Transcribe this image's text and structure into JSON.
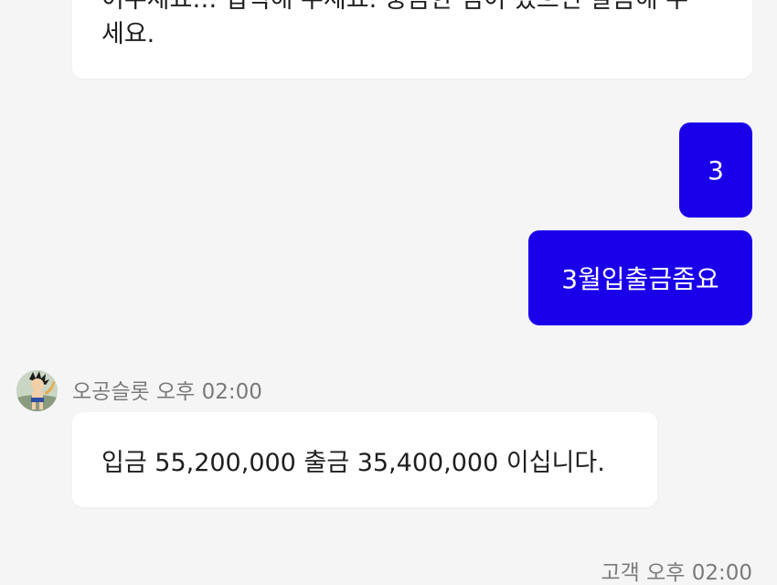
{
  "messages": {
    "previous": {
      "line1": "어주세요… 입력해 주세요. 궁금한 점이 있으면 말씀해 주",
      "line2": "세요."
    },
    "outgoing": [
      {
        "text": "3"
      },
      {
        "text": "3월입출금좀요"
      }
    ],
    "incoming": {
      "sender": "오공슬롯",
      "time": "오후 02:00",
      "text": "입금 55,200,000 출금 35,400,000 이십니다."
    },
    "customer": {
      "label": "고객",
      "time": "오후 02:00"
    }
  },
  "colors": {
    "background": "#f5f5f6",
    "outgoing_bubble": "#1a00e8",
    "incoming_bubble": "#ffffff",
    "meta_text": "#7a7a7a"
  },
  "icons": {
    "avatar": "character-avatar"
  }
}
